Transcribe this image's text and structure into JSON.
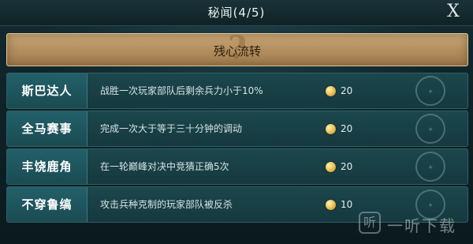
{
  "header": {
    "title": "秘闻(4/5)",
    "close_label": "X"
  },
  "banner": {
    "text": "残心流转",
    "icon": "question-mark"
  },
  "tasks": [
    {
      "name": "斯巴达人",
      "desc": "战胜一次玩家部队后剩余兵力小于10%",
      "reward": "20",
      "status_icon": "completed-stamp"
    },
    {
      "name": "全马赛事",
      "desc": "完成一次大于等于三十分钟的调动",
      "reward": "20",
      "status_icon": "completed-stamp"
    },
    {
      "name": "丰饶鹿角",
      "desc": "在一轮巅峰对决中竞猜正确5次",
      "reward": "20",
      "status_icon": "completed-stamp"
    },
    {
      "name": "不穿鲁缟",
      "desc": "攻击兵种克制的玩家部队被反杀",
      "reward": "10",
      "status_icon": "completed-stamp"
    }
  ],
  "watermark": {
    "logo_glyph": "听",
    "text": "一听下载"
  }
}
